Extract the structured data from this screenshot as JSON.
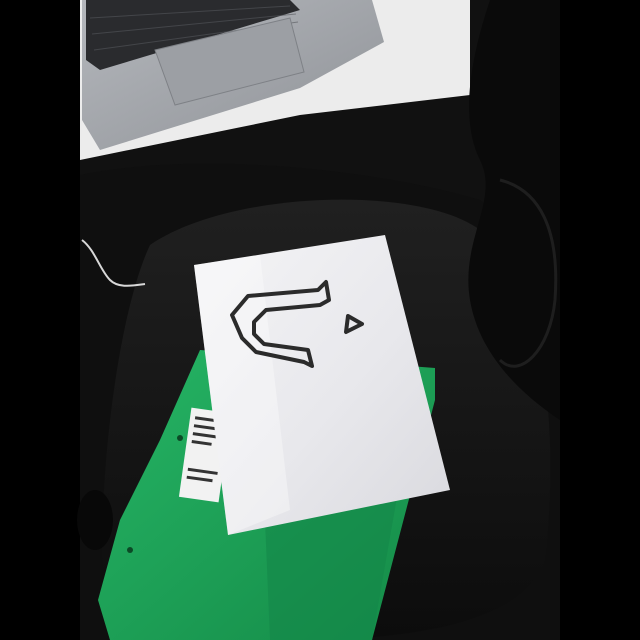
{
  "scene": {
    "subject": "photo",
    "colors": {
      "letterbox": "#000000",
      "chair": "#161616",
      "desk": "#eeeeee",
      "laptop": "#a8abb0",
      "keyboard": "#2a2b2e",
      "paper": "#ebebee",
      "folder": "#1fa85a",
      "folder_dark": "#168a49",
      "ink": "#2b2b2b",
      "jacket": "#0d0d0d"
    }
  }
}
